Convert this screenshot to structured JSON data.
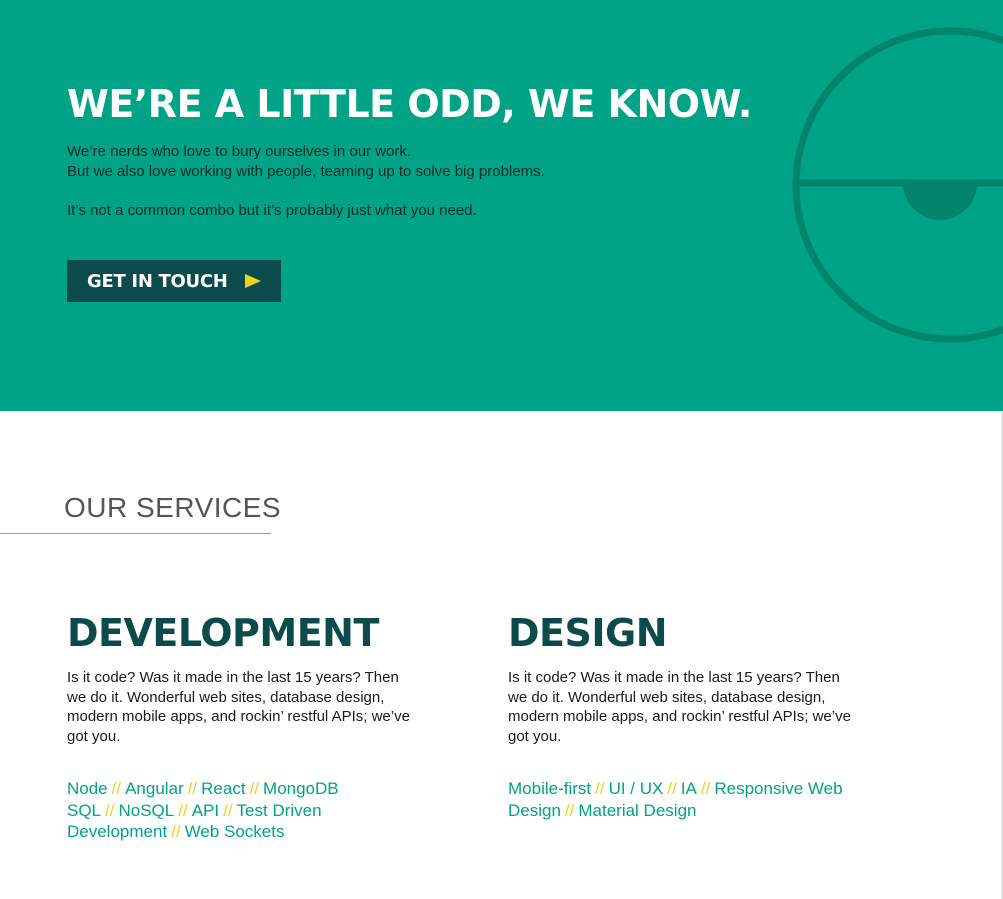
{
  "hero": {
    "title": "WE’RE A LITTLE ODD, WE KNOW.",
    "line1": "We’re nerds who love to bury ourselves in our work.",
    "line2": "But we also love working with people, teaming up to solve big problems.",
    "line3": "It’s not a common combo but it’s probably just what you need.",
    "cta_label": "GET IN TOUCH",
    "cta_icon": "play-arrow-icon",
    "decor_icon": "circle-emblem-icon"
  },
  "services": {
    "title": "OUR SERVICES",
    "columns": [
      {
        "title": "DEVELOPMENT",
        "description": "Is it code? Was it made in the last 15 years? Then we do it. Wonderful web sites, database design, modern mobile apps, and rockin’ restful APIs; we’ve got you.",
        "tags": [
          "Node",
          "Angular",
          "React",
          "MongoDB SQL",
          "NoSQL",
          "API",
          "Test Driven Development",
          "Web Sockets"
        ]
      },
      {
        "title": "DESIGN",
        "description": "Is it code? Was it made in the last 15 years? Then we do it. Wonderful web sites, database design, modern mobile apps, and rockin’ restful APIs; we’ve got you.",
        "tags": [
          "Mobile-first",
          "UI / UX",
          "IA",
          "Responsive Web Design",
          "Material Design"
        ]
      }
    ],
    "separator": "//"
  },
  "colors": {
    "brand_green": "#00a386",
    "dark_teal": "#0c4a4c",
    "accent_yellow": "#f2d21b",
    "decor_teal": "#00846c"
  }
}
